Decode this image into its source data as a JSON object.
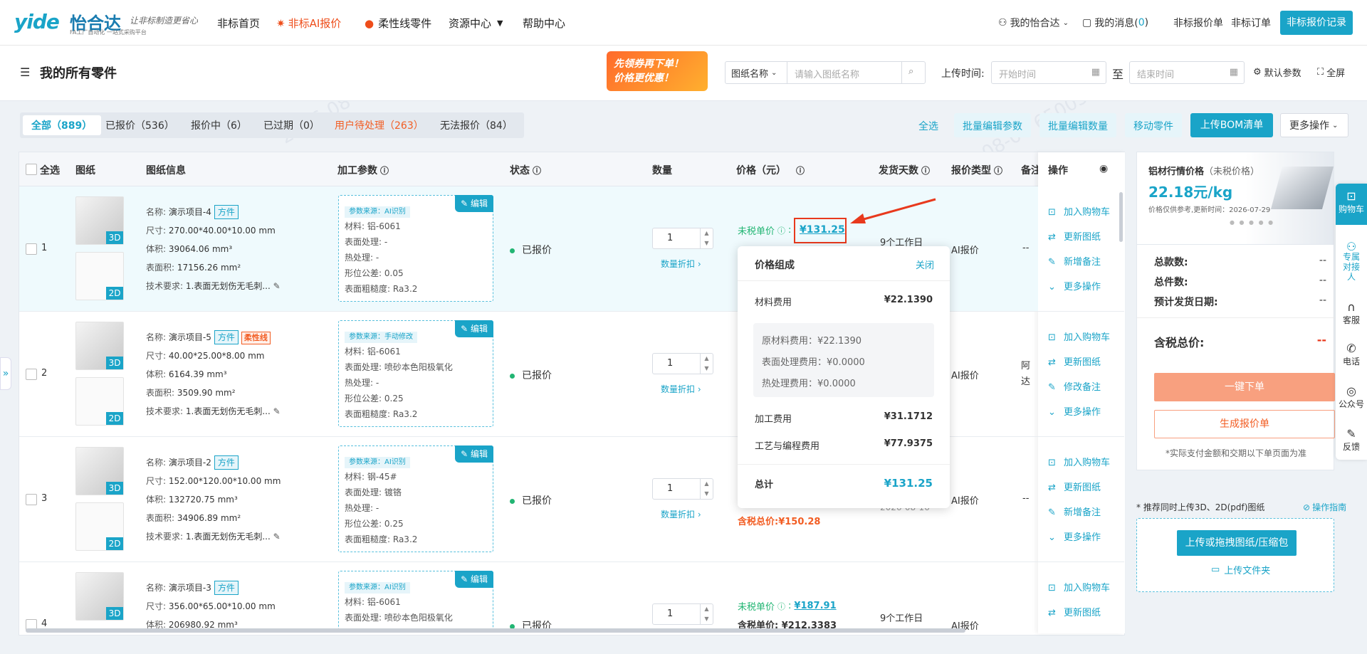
{
  "header": {
    "logo_mark": "yide",
    "logo_name": "怡合达",
    "logo_sub": "FA工厂自动化 一站式采购平台",
    "slogan": "让非标制造更省心",
    "nav": [
      {
        "label": "非标首页"
      },
      {
        "label": "非标AI报价",
        "icon": "fire-icon"
      },
      {
        "label": "柔性线零件",
        "icon": "flame-icon"
      },
      {
        "label": "资源中心",
        "icon": "caret-down-icon"
      },
      {
        "label": "帮助中心"
      }
    ],
    "user_label": "我的怡合达",
    "msg_label": "我的消息(",
    "msg_count": "0",
    "msg_close": ")",
    "quote_order_label": "非标报价单",
    "order_label": "非标订单",
    "quote_record_btn": "非标报价记录"
  },
  "subheader": {
    "title": "我的所有零件",
    "promo_line1": "先领券再下单！",
    "promo_line2": "价格更优惠！",
    "search_select": "图纸名称",
    "search_placeholder": "请输入图纸名称",
    "upload_time_label": "上传时间:",
    "start_placeholder": "开始时间",
    "to_label": "至",
    "end_placeholder": "结束时间",
    "default_params": "默认参数",
    "fullscreen": "全屏"
  },
  "tabs": [
    {
      "label": "全部（889）"
    },
    {
      "label": "已报价（536）"
    },
    {
      "label": "报价中（6）"
    },
    {
      "label": "已过期（0）"
    },
    {
      "label": "用户待处理（263）"
    },
    {
      "label": "无法报价（84）"
    }
  ],
  "toolbar": {
    "select_all": "全选",
    "batch_params": "批量编辑参数",
    "batch_qty": "批量编辑数量",
    "move_parts": "移动零件",
    "upload_bom": "上传BOM清单",
    "more_ops": "更多操作"
  },
  "table": {
    "headers": {
      "select_all": "全选",
      "drawing": "图纸",
      "drawing_info": "图纸信息",
      "params": "加工参数",
      "status": "状态",
      "qty": "数量",
      "price": "价格（元）",
      "ship_days": "发货天数",
      "quote_type": "报价类型",
      "remark": "备注",
      "ops": "操作"
    },
    "labels": {
      "name": "名称:",
      "size": "尺寸:",
      "volume": "体积:",
      "area": "表面积:",
      "tech": "技术要求:",
      "material": "材料:",
      "surface": "表面处理:",
      "heat": "热处理:",
      "tolerance": "形位公差:",
      "roughness": "表面粗糙度:",
      "edit": "编辑",
      "discount": "数量折扣 ›",
      "unit_price_notax": "未税单价",
      "unit_price_tax": "含税单价:",
      "total_tax": "含税总价:"
    },
    "rows": [
      {
        "no": "1",
        "name": "演示项目-4",
        "shape": "方件",
        "size": "270.00*40.00*10.00 mm",
        "volume": "39064.06 mm³",
        "area": "17156.26 mm²",
        "tech": "1.表面无划伤无毛刺...",
        "src": "参数来源：AI识别",
        "material": "铝-6061",
        "surface": "-",
        "heat": "-",
        "tolerance": "0.05",
        "roughness": "Ra3.2",
        "status": "已报价",
        "qty": "1",
        "price": "¥131.25",
        "days": "9个工作日",
        "qtype": "AI报价",
        "remark": "--",
        "ops": [
          "加入购物车",
          "更新图纸",
          "新增备注",
          "更多操作"
        ]
      },
      {
        "no": "2",
        "name": "演示项目-5",
        "shape": "方件",
        "extra_tag": "柔性线",
        "size": "40.00*25.00*8.00 mm",
        "volume": "6164.39 mm³",
        "area": "3509.90 mm²",
        "tech": "1.表面无划伤无毛刺...",
        "src": "参数来源：手动修改",
        "material": "铝-6061",
        "surface": "喷砂本色阳极氧化",
        "heat": "-",
        "tolerance": "0.25",
        "roughness": "Ra3.2",
        "status": "已报价",
        "qty": "1",
        "qtype": "AI报价",
        "remark": "阿达大四",
        "ops": [
          "加入购物车",
          "更新图纸",
          "修改备注",
          "更多操作"
        ]
      },
      {
        "no": "3",
        "name": "演示项目-2",
        "shape": "方件",
        "size": "152.00*120.00*10.00 mm",
        "volume": "132720.75 mm³",
        "area": "34906.89 mm²",
        "tech": "1.表面无划伤无毛刺...",
        "src": "参数来源：AI识别",
        "material": "钢-45#",
        "surface": "镀铬",
        "heat": "-",
        "tolerance": "0.25",
        "roughness": "Ra3.2",
        "status": "已报价",
        "qty": "1",
        "total_tax": "¥150.28",
        "date": "2026-08-16",
        "qtype": "AI报价",
        "remark": "--",
        "ops": [
          "加入购物车",
          "更新图纸",
          "新增备注",
          "更多操作"
        ]
      },
      {
        "no": "4",
        "name": "演示项目-3",
        "shape": "方件",
        "size": "356.00*65.00*10.00 mm",
        "volume": "206980.92 mm³",
        "src": "参数来源：AI识别",
        "material": "铝-6061",
        "surface": "喷砂本色阳极氧化",
        "status": "已报价",
        "qty": "1",
        "price": "¥187.91",
        "price_tax": "¥212.3383",
        "days": "9个工作日",
        "qtype": "AI报价",
        "ops": [
          "加入购物车",
          "更新图纸"
        ]
      }
    ]
  },
  "popup": {
    "title": "价格组成",
    "close": "关闭",
    "material_fee_label": "材料费用",
    "material_fee": "¥22.1390",
    "raw_label": "原材料费用：",
    "raw": "¥22.1390",
    "surface_label": "表面处理费用：",
    "surface": "¥0.0000",
    "heat_label": "热处理费用：",
    "heat": "¥0.0000",
    "process_label": "加工费用",
    "process": "¥31.1712",
    "prog_label": "工艺与编程费用",
    "prog": "¥77.9375",
    "total_label": "总计",
    "total": "¥131.25"
  },
  "right_panel": {
    "material_title": "铝材行情价格",
    "material_note": "（未税价格）",
    "material_price": "22.18元/kg",
    "material_update": "价格仅供参考,更新时间：2026-07-29",
    "total_count_label": "总款数:",
    "total_count": "--",
    "total_pieces_label": "总件数:",
    "total_pieces": "--",
    "ship_date_label": "预计发货日期:",
    "ship_date": "--",
    "total_price_label": "含税总价:",
    "total_price": "--",
    "order_btn": "一键下单",
    "gen_quote_btn": "生成报价单",
    "pay_note": "*实际支付金额和交期以下单页面为准",
    "upload_tip": "* 推荐同时上传3D、2D(pdf)图纸",
    "guide": "操作指南",
    "upload_btn": "上传或拖拽图纸/压缩包",
    "upload_folder": "上传文件夹"
  },
  "sidebar": [
    {
      "label": "购物车",
      "icon": "cart-icon"
    },
    {
      "label": "专属对接人",
      "icon": "person-icon"
    },
    {
      "label": "客服",
      "icon": "headset-icon"
    },
    {
      "label": "电话",
      "icon": "phone-icon"
    },
    {
      "label": "公众号",
      "icon": "wechat-icon"
    },
    {
      "label": "反馈",
      "icon": "feedback-icon"
    }
  ],
  "watermark": "2026-08-07  65005",
  "colors": {
    "accent": "#1aa4c8",
    "orange": "#f25d23",
    "red": "#e8391d",
    "green": "#22b573"
  }
}
